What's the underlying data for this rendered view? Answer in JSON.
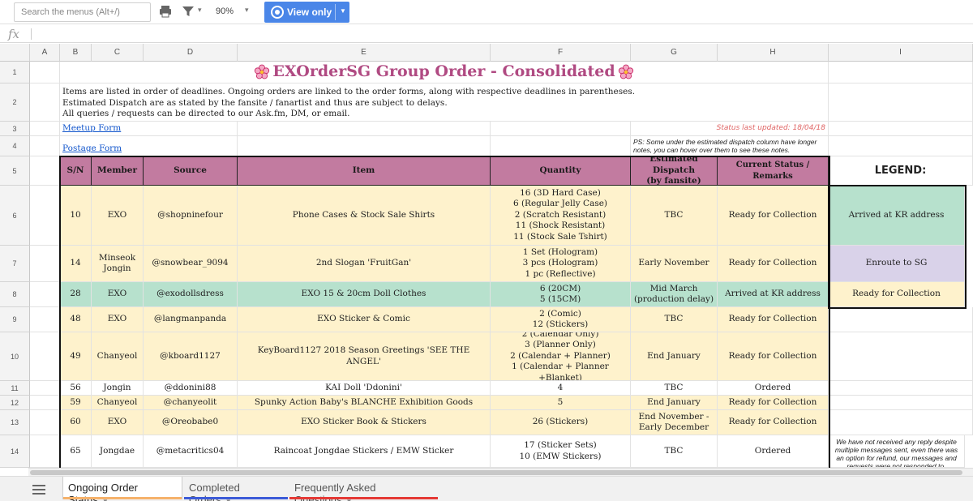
{
  "toolbar": {
    "search_placeholder": "Search the menus (Alt+/)",
    "zoom": "90%",
    "view_mode": "View only"
  },
  "formula_bar": {
    "fx": "fx"
  },
  "columns": [
    "A",
    "B",
    "C",
    "D",
    "E",
    "F",
    "G",
    "H",
    "I"
  ],
  "row_numbers": [
    "1",
    "2",
    "3",
    "4",
    "5",
    "6",
    "7",
    "8",
    "9",
    "10",
    "11",
    "12",
    "13",
    "14"
  ],
  "sheet": {
    "title": "EXOrderSG Group Order - Consolidated",
    "intro_line1": "Items are listed in order of deadlines. Ongoing orders are linked to the order forms, along with respective deadlines in parentheses.",
    "intro_line2": "Estimated Dispatch are as stated by the fansite / fanartist and thus are subject to delays.",
    "intro_line3": "All queries / requests can be directed to our Ask.fm, DM, or email.",
    "meetup_link": "Meetup Form",
    "postage_link": "Postage Form",
    "status_updated": "Status last updated: 18/04/18",
    "ps_note": "PS: Some under the estimated dispatch column have longer notes, you can hover over them to see these notes.",
    "headers": {
      "sn": "S/N",
      "member": "Member",
      "source": "Source",
      "item": "Item",
      "quantity": "Quantity",
      "dispatch_line1": "Estimated Dispatch",
      "dispatch_line2": "(by fansite)",
      "status": "Current Status / Remarks"
    },
    "legend_title": "LEGEND:",
    "legend": [
      "Arrived at KR address",
      "Enroute to SG",
      "Ready for Collection"
    ],
    "refund_note": "We have not received any reply despite multiple messages sent, even there was an option for refund, our messages and requests were not responded to."
  },
  "orders": [
    {
      "sn": "10",
      "member_1": "EXO",
      "member_2": "",
      "source": "@shopninefour",
      "item": "Phone Cases & Stock Sale Shirts",
      "q1": "16 (3D Hard Case)",
      "q2": "6 (Regular Jelly Case)",
      "q3": "2 (Scratch Resistant)",
      "q4": "11 (Shock Resistant)",
      "q5": "11 (Stock Sale Tshirt)",
      "d1": "TBC",
      "d2": "",
      "status": "Ready for Collection"
    },
    {
      "sn": "14",
      "member_1": "Minseok",
      "member_2": "Jongin",
      "source": "@snowbear_9094",
      "item": "2nd Slogan 'FruitGan'",
      "q1": "1 Set (Hologram)",
      "q2": "3 pcs (Hologram)",
      "q3": "1 pc (Reflective)",
      "q4": "",
      "q5": "",
      "d1": "Early November",
      "d2": "",
      "status": "Ready for Collection"
    },
    {
      "sn": "28",
      "member_1": "EXO",
      "member_2": "",
      "source": "@exodollsdress",
      "item": "EXO 15 & 20cm Doll Clothes",
      "q1": "6 (20CM)",
      "q2": "5 (15CM)",
      "q3": "",
      "q4": "",
      "q5": "",
      "d1": "Mid March",
      "d2": "(production delay)",
      "status": "Arrived at KR address"
    },
    {
      "sn": "48",
      "member_1": "EXO",
      "member_2": "",
      "source": "@langmanpanda",
      "item": "EXO Sticker & Comic",
      "q1": "2 (Comic)",
      "q2": "12 (Stickers)",
      "q3": "",
      "q4": "",
      "q5": "",
      "d1": "TBC",
      "d2": "",
      "status": "Ready for Collection"
    },
    {
      "sn": "49",
      "member_1": "Chanyeol",
      "member_2": "",
      "source": "@kboard1127",
      "item": "KeyBoard1127 2018 Season Greetings 'SEE THE ANGEL'",
      "q1": "2 (Calendar Only)",
      "q2": "3 (Planner Only)",
      "q3": "2 (Calendar + Planner)",
      "q4": "1 (Calendar + Planner +Blanket)",
      "q5": "",
      "d1": "End January",
      "d2": "",
      "status": "Ready for Collection"
    },
    {
      "sn": "56",
      "member_1": "Jongin",
      "member_2": "",
      "source": "@ddonini88",
      "item": "KAI Doll 'Ddonini'",
      "q1": "4",
      "q2": "",
      "q3": "",
      "q4": "",
      "q5": "",
      "d1": "TBC",
      "d2": "",
      "status": "Ordered"
    },
    {
      "sn": "59",
      "member_1": "Chanyeol",
      "member_2": "",
      "source": "@chanyeolit",
      "item": "Spunky Action Baby's BLANCHE Exhibition Goods",
      "q1": "5",
      "q2": "",
      "q3": "",
      "q4": "",
      "q5": "",
      "d1": "End January",
      "d2": "",
      "status": "Ready for Collection"
    },
    {
      "sn": "60",
      "member_1": "EXO",
      "member_2": "",
      "source": "@Oreobabe0",
      "item": "EXO Sticker Book & Stickers",
      "q1": "26 (Stickers)",
      "q2": "",
      "q3": "",
      "q4": "",
      "q5": "",
      "d1": "End November -",
      "d2": "Early December",
      "status": "Ready for Collection"
    },
    {
      "sn": "65",
      "member_1": "Jongdae",
      "member_2": "",
      "source": "@metacritics04",
      "item": "Raincoat Jongdae Stickers / EMW Sticker",
      "q1": "17 (Sticker Sets)",
      "q2": "10 (EMW Stickers)",
      "q3": "",
      "q4": "",
      "q5": "",
      "d1": "TBC",
      "d2": "",
      "status": "Ordered"
    }
  ],
  "tabs": [
    {
      "label": "Ongoing Order Status",
      "color": "#f6b26b"
    },
    {
      "label": "Completed Orders",
      "color": "#3c5bd8"
    },
    {
      "label": "Frequently Asked Questions",
      "color": "#e53935"
    }
  ],
  "colors": {
    "header_bg": "#c27ba0",
    "ready": "#fef2cc",
    "arrived": "#b7e1cd",
    "enroute": "#d9d2e9",
    "title": "#b04a82",
    "accent": "#4a86e8"
  }
}
